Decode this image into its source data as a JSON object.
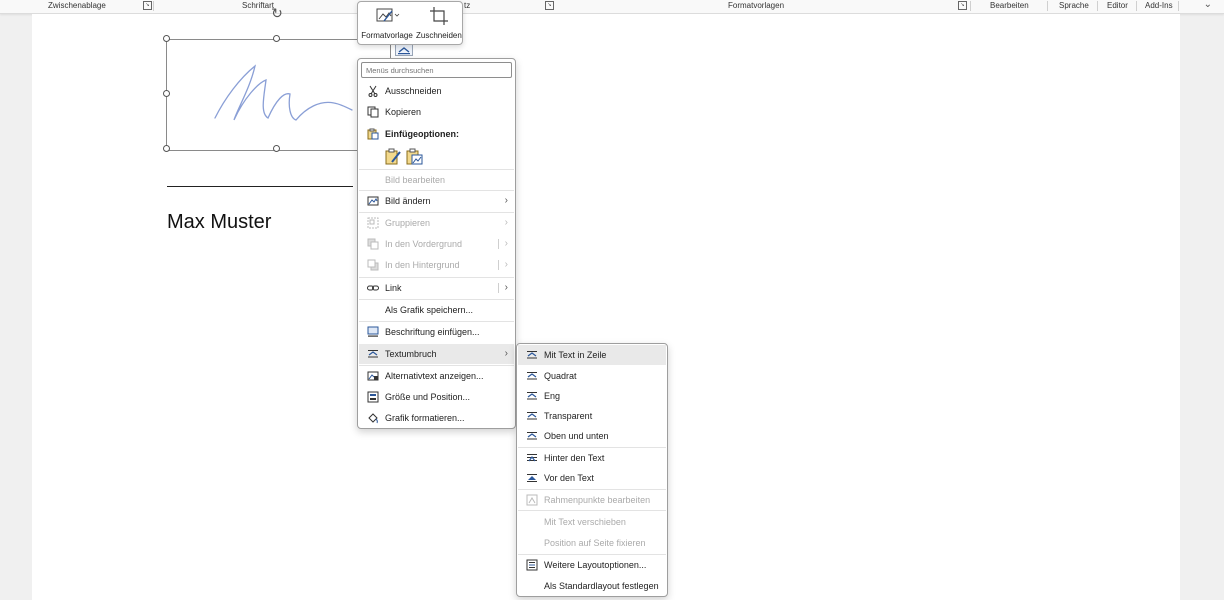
{
  "ribbon": {
    "groups": [
      "Zwischenablage",
      "Schriftart",
      "tz",
      "Formatvorlagen"
    ],
    "buttons": [
      "Bearbeiten",
      "Sprache",
      "Editor",
      "Add-Ins"
    ]
  },
  "document": {
    "signer_name": "Max Muster"
  },
  "minibar": {
    "style_label": "Formatvorlage",
    "crop_label": "Zuschneiden"
  },
  "context_menu": {
    "search_placeholder": "Menüs durchsuchen",
    "items": [
      {
        "label": "Ausschneiden",
        "icon": "scissors-icon",
        "enabled": true
      },
      {
        "label": "Kopieren",
        "icon": "copy-icon",
        "enabled": true
      },
      {
        "label": "Einfügeoptionen:",
        "icon": "paste-icon",
        "enabled": true
      },
      {
        "label": "Bild bearbeiten",
        "enabled": false
      },
      {
        "label": "Bild ändern",
        "icon": "change-picture-icon",
        "enabled": true
      },
      {
        "label": "Gruppieren",
        "icon": "group-icon",
        "enabled": false
      },
      {
        "label": "In den Vordergrund",
        "icon": "bring-forward-icon",
        "enabled": false
      },
      {
        "label": "In den Hintergrund",
        "icon": "send-backward-icon",
        "enabled": false
      },
      {
        "label": "Link",
        "icon": "link-icon",
        "enabled": true
      },
      {
        "label": "Als Grafik speichern...",
        "enabled": true
      },
      {
        "label": "Beschriftung einfügen...",
        "icon": "caption-icon",
        "enabled": true
      },
      {
        "label": "Textumbruch",
        "icon": "wrap-text-icon",
        "enabled": true
      },
      {
        "label": "Alternativtext anzeigen...",
        "icon": "alt-text-icon",
        "enabled": true
      },
      {
        "label": "Größe und Position...",
        "icon": "size-position-icon",
        "enabled": true
      },
      {
        "label": "Grafik formatieren...",
        "icon": "format-graphic-icon",
        "enabled": true
      }
    ]
  },
  "wrap_submenu": {
    "items": [
      {
        "label": "Mit Text in Zeile",
        "enabled": true
      },
      {
        "label": "Quadrat",
        "enabled": true
      },
      {
        "label": "Eng",
        "enabled": true
      },
      {
        "label": "Transparent",
        "enabled": true
      },
      {
        "label": "Oben und unten",
        "enabled": true
      },
      {
        "label": "Hinter den Text",
        "enabled": true
      },
      {
        "label": "Vor den Text",
        "enabled": true
      },
      {
        "label": "Rahmenpunkte bearbeiten",
        "enabled": false
      },
      {
        "label": "Mit Text verschieben",
        "enabled": false
      },
      {
        "label": "Position auf Seite fixieren",
        "enabled": false
      },
      {
        "label": "Weitere Layoutoptionen...",
        "enabled": true
      },
      {
        "label": "Als Standardlayout festlegen",
        "enabled": true
      }
    ]
  },
  "colors": {
    "accent": "#2b579a",
    "signature_ink": "#8a9fd6"
  }
}
